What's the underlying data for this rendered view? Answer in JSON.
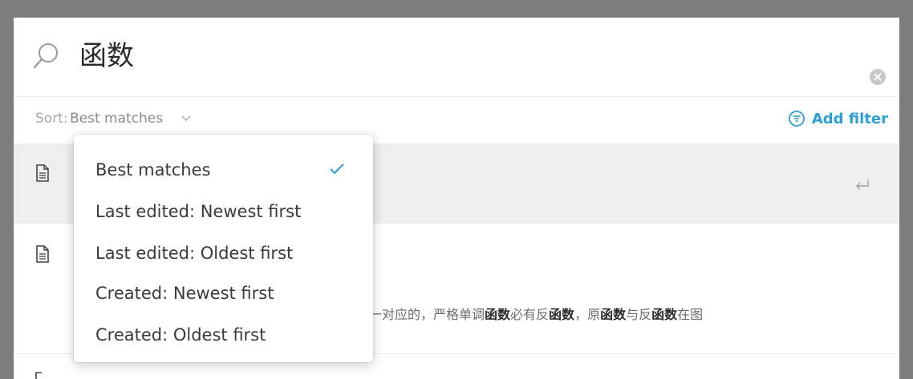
{
  "search": {
    "query": "函数"
  },
  "sort": {
    "label": "Sort:",
    "value": "Best matches"
  },
  "filter": {
    "label": "Add filter"
  },
  "sort_menu": {
    "items": [
      {
        "label": "Best matches",
        "selected": true
      },
      {
        "label": "Last edited: Newest first",
        "selected": false
      },
      {
        "label": "Last edited: Oldest first",
        "selected": false
      },
      {
        "label": "Created: Newest first",
        "selected": false
      },
      {
        "label": "Created: Oldest first",
        "selected": false
      }
    ]
  },
  "results": {
    "second_snippet": [
      {
        "text": "一对应的，严格单调",
        "bold": false
      },
      {
        "text": "函数",
        "bold": true
      },
      {
        "text": "必有反",
        "bold": false
      },
      {
        "text": "函数",
        "bold": true
      },
      {
        "text": "，原",
        "bold": false
      },
      {
        "text": "函数",
        "bold": true
      },
      {
        "text": "与反",
        "bold": false
      },
      {
        "text": "函数",
        "bold": true
      },
      {
        "text": "在图",
        "bold": false
      }
    ]
  },
  "colors": {
    "accent": "#2b9fd6",
    "backdrop": "#7c7c7c",
    "selected_row": "#eeeeee"
  },
  "icons": [
    "search-icon",
    "clear-icon",
    "chevron-down-icon",
    "filter-icon",
    "page-icon",
    "enter-icon",
    "check-icon"
  ]
}
